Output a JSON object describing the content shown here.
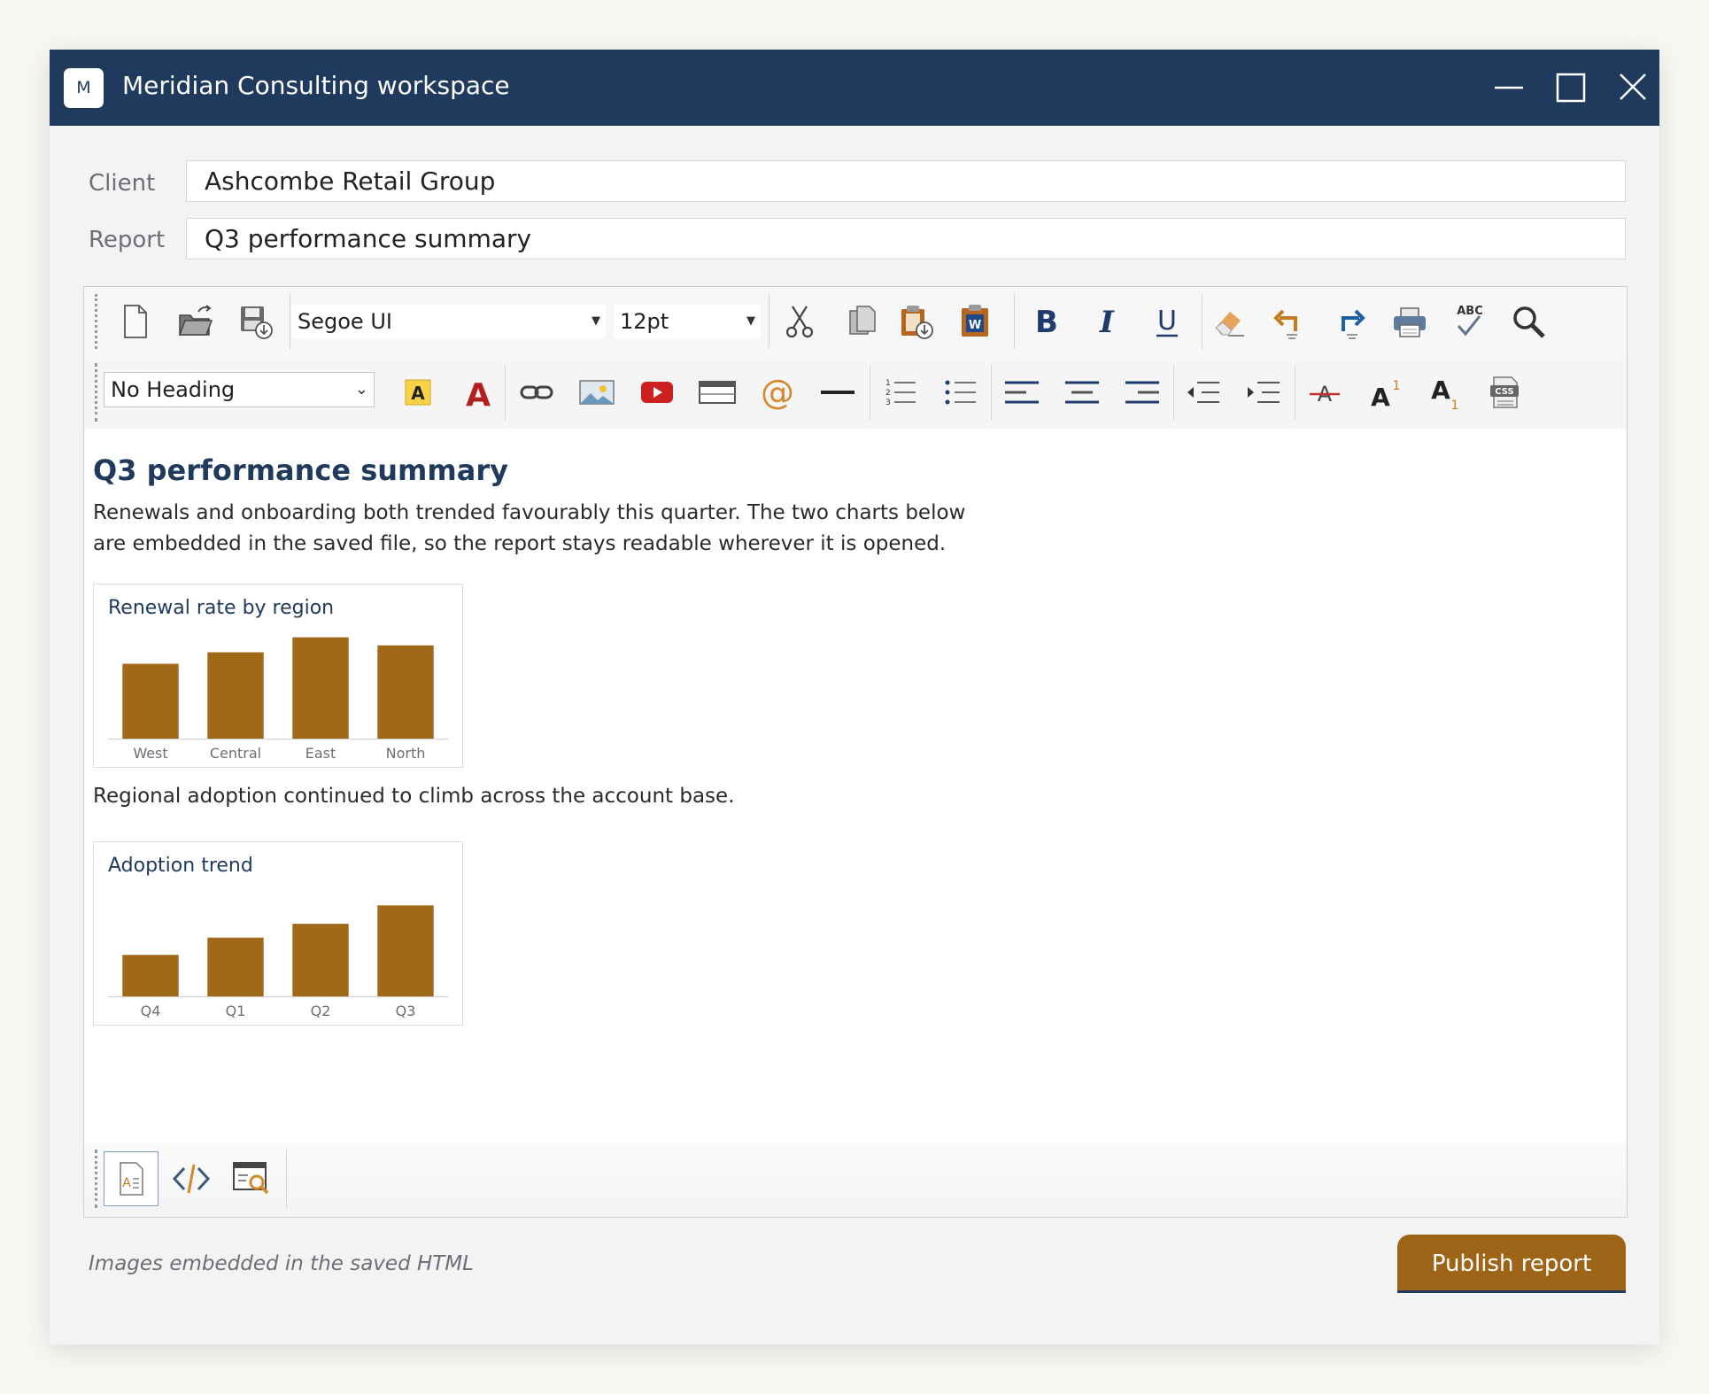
{
  "window": {
    "logo_letter": "M",
    "title": "Meridian Consulting workspace"
  },
  "form": {
    "client_label": "Client",
    "client_value": "Ashcombe Retail Group",
    "report_label": "Report",
    "report_value": "Q3 performance summary"
  },
  "toolbar": {
    "font_family": "Segoe UI",
    "font_size": "12pt",
    "heading_style": "No Heading",
    "spellcheck_label": "ABC",
    "css_label": "CSS"
  },
  "document": {
    "heading": "Q3 performance summary",
    "intro": "Renewals and onboarding both trended favourably this quarter. The two charts below are embedded in the saved file, so the report stays readable wherever it is opened.",
    "between": "Regional adoption continued to climb across the account base."
  },
  "chart_data": [
    {
      "type": "bar",
      "title": "Renewal rate by region",
      "categories": [
        "West",
        "Central",
        "East",
        "North"
      ],
      "values": [
        65,
        75,
        88,
        81
      ],
      "ylim": [
        0,
        100
      ],
      "color": "#a06818",
      "grid": false
    },
    {
      "type": "bar",
      "title": "Adoption trend",
      "categories": [
        "Q4",
        "Q1",
        "Q2",
        "Q3"
      ],
      "values": [
        36,
        51,
        63,
        79
      ],
      "ylim": [
        0,
        100
      ],
      "color": "#a06818",
      "grid": false
    }
  ],
  "footer": {
    "status": "Images embedded in the saved HTML",
    "publish_label": "Publish report"
  },
  "colors": {
    "titlebar": "#1f3a5c",
    "accent": "#9e6418",
    "bar": "#a06818"
  }
}
